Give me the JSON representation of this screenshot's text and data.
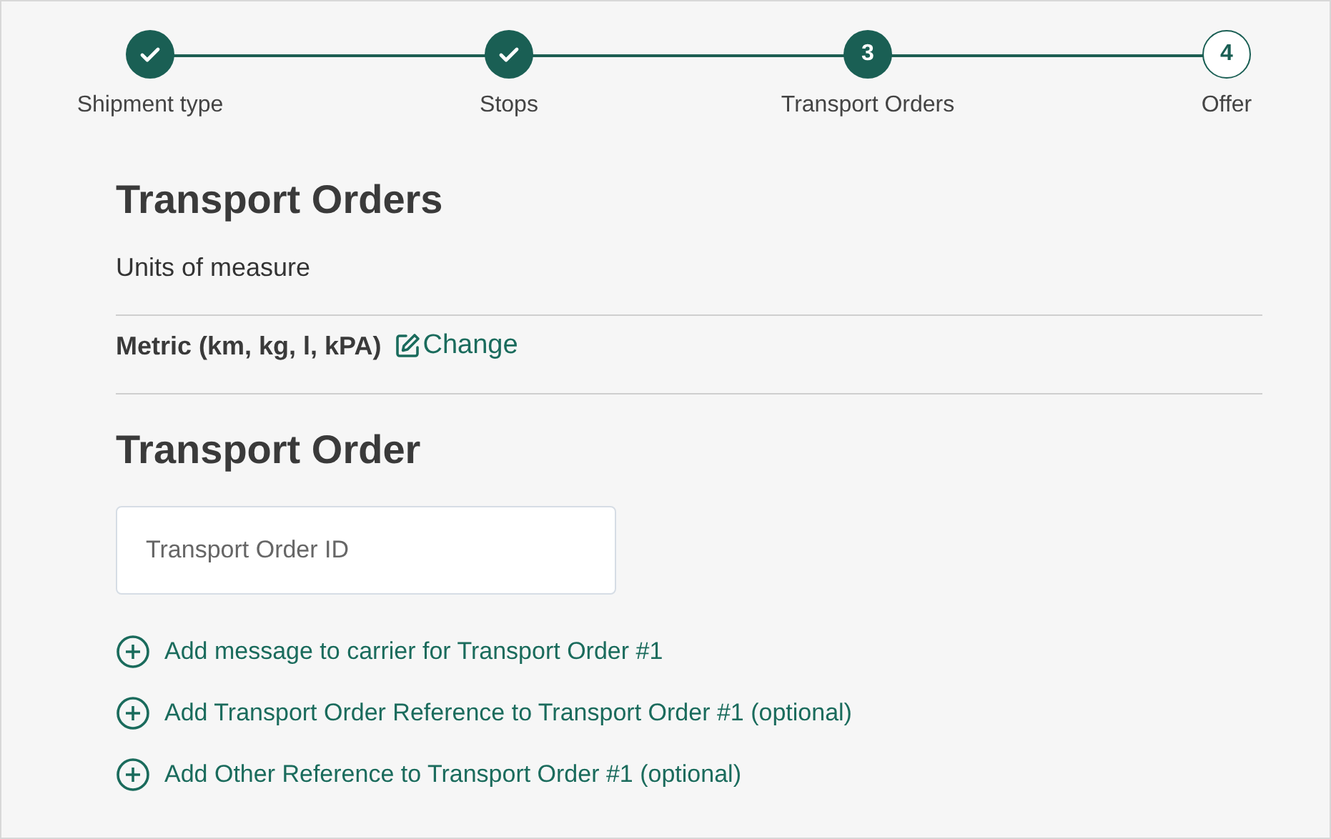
{
  "steps": [
    {
      "label": "Shipment type",
      "kind": "done"
    },
    {
      "label": "Stops",
      "kind": "done"
    },
    {
      "label": "Transport Orders",
      "number": "3",
      "kind": "current"
    },
    {
      "label": "Offer",
      "number": "4",
      "kind": "upcoming"
    }
  ],
  "section_title": "Transport Orders",
  "units_label": "Units of measure",
  "units_value": "Metric (km, kg, l, kPA)",
  "change_link": "Change",
  "order_title": "Transport Order",
  "order_id_field": {
    "placeholder": "Transport Order ID"
  },
  "add_links": [
    "Add message to carrier for Transport Order #1",
    "Add Transport Order Reference to Transport Order #1 (optional)",
    "Add Other Reference to Transport Order #1 (optional)"
  ]
}
